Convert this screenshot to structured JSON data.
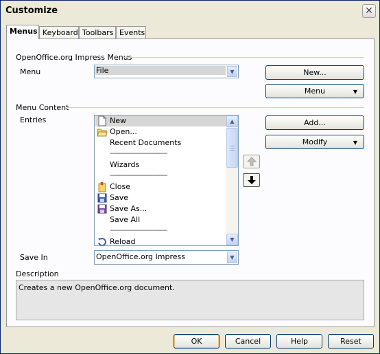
{
  "window": {
    "title": "Customize"
  },
  "tabs": [
    {
      "label": "Menus",
      "active": true
    },
    {
      "label": "Keyboard",
      "active": false
    },
    {
      "label": "Toolbars",
      "active": false
    },
    {
      "label": "Events",
      "active": false
    }
  ],
  "menus_group": {
    "heading": "OpenOffice.org Impress Menus",
    "menu_label": "Menu",
    "menu_value": "File",
    "new_button": "New...",
    "menu_button": "Menu"
  },
  "content_group": {
    "heading": "Menu Content",
    "entries_label": "Entries",
    "add_button": "Add...",
    "modify_button": "Modify",
    "entries": [
      {
        "label": "New",
        "icon": "new-document-icon",
        "selected": true
      },
      {
        "label": "Open...",
        "icon": "open-folder-icon"
      },
      {
        "label": "Recent Documents",
        "icon": ""
      },
      {
        "label": "--------------------------------",
        "separator": true
      },
      {
        "label": "Wizards",
        "icon": ""
      },
      {
        "label": "--------------------------------",
        "separator": true
      },
      {
        "label": "Close",
        "icon": "close-document-icon"
      },
      {
        "label": "Save",
        "icon": "save-icon"
      },
      {
        "label": "Save As...",
        "icon": "save-as-icon"
      },
      {
        "label": "Save All",
        "icon": ""
      },
      {
        "label": "--------------------------------",
        "separator": true
      },
      {
        "label": "Reload",
        "icon": "reload-icon"
      }
    ]
  },
  "save_in": {
    "label": "Save In",
    "value": "OpenOffice.org Impress"
  },
  "description": {
    "label": "Description",
    "text": "Creates a new OpenOffice.org document."
  },
  "footer": {
    "ok": "OK",
    "cancel": "Cancel",
    "help": "Help",
    "reset": "Reset"
  },
  "colors": {
    "accent": "#003c74",
    "selection": "#d6d6d6",
    "dialog_bg": "#ece9d8"
  }
}
